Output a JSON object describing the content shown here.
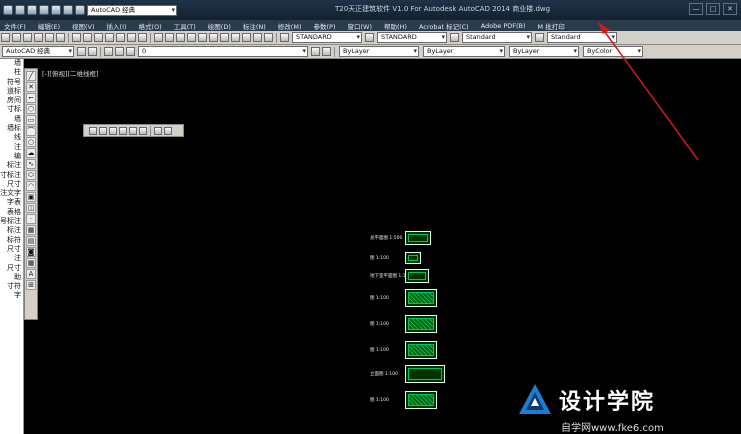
{
  "titlebar": {
    "workspace": "AutoCAD 经典",
    "title": "T20天正建筑软件 V1.0 For Autodesk AutoCAD 2014    商业楼.dwg",
    "win_min": "—",
    "win_max": "□",
    "win_close": "✕"
  },
  "menu": [
    "文件(F)",
    "编辑(E)",
    "视图(V)",
    "插入(I)",
    "格式(O)",
    "工具(T)",
    "绘图(D)",
    "标注(N)",
    "修改(M)",
    "参数(P)",
    "窗口(W)",
    "帮助(H)",
    "Acrobat 标记(C)",
    "Adobe PDF(B)",
    "M 批打印"
  ],
  "toolbar1": {
    "text_style": "STANDARD",
    "dim_style": "STANDARD",
    "table_style": "Standard",
    "multileader_style": "Standard"
  },
  "toolbar2": {
    "workspace": "AutoCAD 经典",
    "layer": "0",
    "color": "ByLayer",
    "linetype": "ByLayer",
    "lineweight": "ByLayer",
    "plotstyle": "ByColor"
  },
  "left_panel": [
    "",
    "",
    "墙",
    "柱",
    "",
    "符号",
    "道标",
    "房间",
    "寸标",
    "",
    "墙",
    "",
    "",
    "墙标",
    "线",
    "注",
    "编",
    "标注",
    "寸标注",
    "尺寸",
    "注文字",
    "字表",
    "表格",
    "号标注",
    "标注",
    "标符",
    "尺寸",
    "注",
    "尺寸",
    "助",
    "寸符",
    "字"
  ],
  "viewport_label": "[-][俯视][二维线框]",
  "sheets": [
    {
      "label": "总平面图 1:500"
    },
    {
      "label": "图 1:100"
    },
    {
      "label": "地下室平面图 1:100"
    },
    {
      "label": "图 1:100"
    },
    {
      "label": "图 1:100"
    },
    {
      "label": "图 1:100"
    },
    {
      "label": "立面图 1:100"
    },
    {
      "label": "图 1:100"
    }
  ],
  "watermark": {
    "name": "设计学院",
    "url": "自学网www.fke6.com"
  },
  "colors": {
    "arrow": "#d11a1a",
    "canvas": "#000000",
    "sheet_line": "#00ff88"
  }
}
